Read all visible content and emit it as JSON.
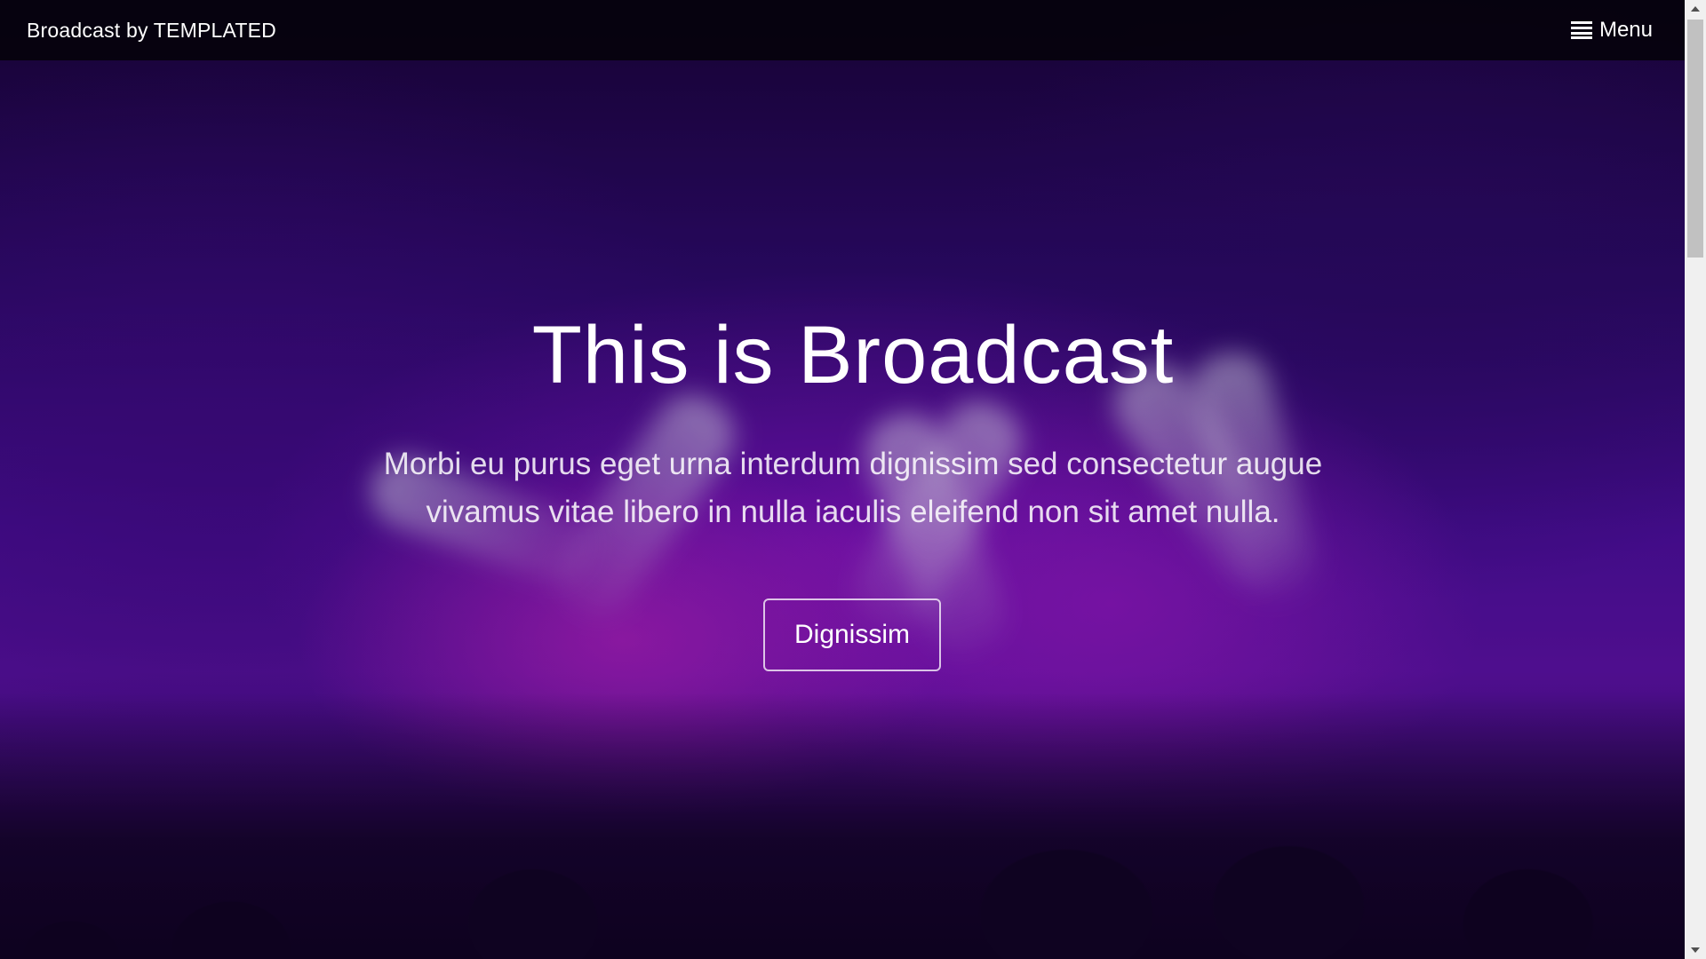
{
  "header": {
    "logo_text": "Broadcast by TEMPLATED",
    "menu_label": "Menu",
    "menu_icon": "hamburger-icon"
  },
  "hero": {
    "title": "This is Broadcast",
    "subtitle": "Morbi eu purus eget urna interdum dignissim sed consectetur augue vivamus vitae libero in nulla iaculis eleifend non sit amet nulla.",
    "button_label": "Dignissim"
  },
  "colors": {
    "header_background": "#05020c",
    "text": "#ffffff",
    "hero_accent": "#5a129e",
    "scrollbar_track": "#f0f0f0",
    "scrollbar_thumb": "#c1c1c1"
  },
  "scrollbar": {
    "up_icon": "arrow-up-icon",
    "down_icon": "arrow-down-icon"
  }
}
